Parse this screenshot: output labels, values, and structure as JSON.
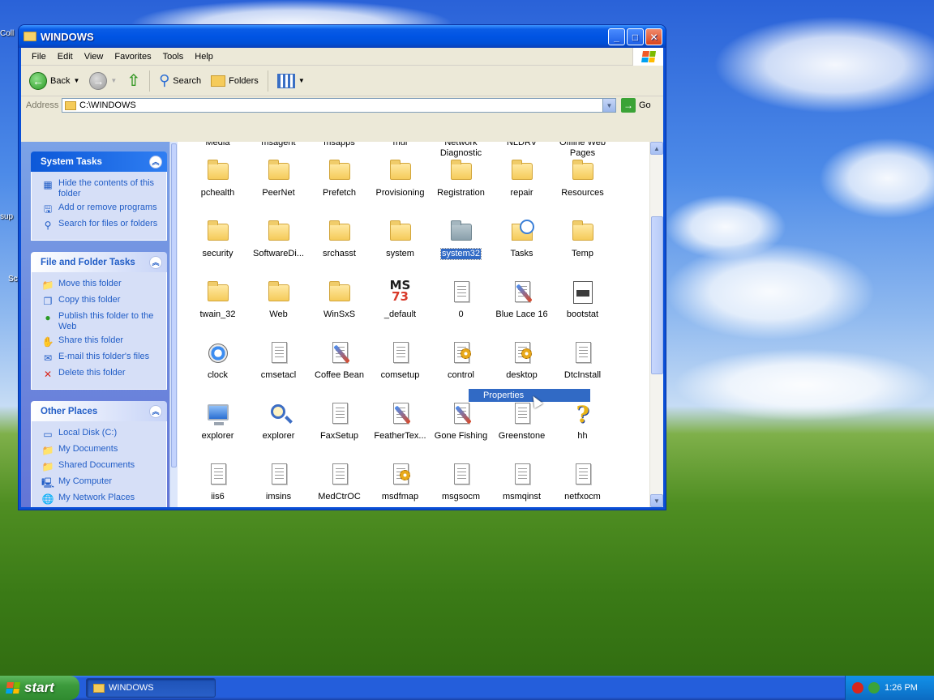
{
  "window": {
    "title": "WINDOWS",
    "menus": [
      "File",
      "Edit",
      "View",
      "Favorites",
      "Tools",
      "Help"
    ]
  },
  "toolbar": {
    "back": "Back",
    "search": "Search",
    "folders": "Folders"
  },
  "address": {
    "label": "Address",
    "value": "C:\\WINDOWS",
    "go": "Go"
  },
  "taskpane": {
    "system_tasks": {
      "title": "System Tasks",
      "items": [
        "Hide the contents of this folder",
        "Add or remove programs",
        "Search for files or folders"
      ]
    },
    "file_tasks": {
      "title": "File and Folder Tasks",
      "items": [
        "Move this folder",
        "Copy this folder",
        "Publish this folder to the Web",
        "Share this folder",
        "E-mail this folder's files",
        "Delete this folder"
      ]
    },
    "other_places": {
      "title": "Other Places",
      "items": [
        "Local Disk (C:)",
        "My Documents",
        "Shared Documents",
        "My Computer",
        "My Network Places"
      ]
    }
  },
  "files": {
    "row0": [
      "Media",
      "msagent",
      "msapps",
      "mui",
      "Network Diagnostic",
      "NLDRV",
      "Offline Web Pages"
    ],
    "row1": [
      "pchealth",
      "PeerNet",
      "Prefetch",
      "Provisioning",
      "Registration",
      "repair",
      "Resources"
    ],
    "row2": [
      "security",
      "SoftwareDi...",
      "srchasst",
      "system",
      "system32",
      "Tasks",
      "Temp"
    ],
    "row3": [
      "twain_32",
      "Web",
      "WinSxS",
      "_default",
      "0",
      "Blue Lace 16",
      "bootstat"
    ],
    "row4": [
      "clock",
      "cmsetacl",
      "Coffee Bean",
      "comsetup",
      "control",
      "desktop",
      "DtcInstall"
    ],
    "row5": [
      "explorer",
      "explorer",
      "FaxSetup",
      "FeatherTex...",
      "Gone Fishing",
      "Greenstone",
      "hh"
    ],
    "row6": [
      "iis6",
      "imsins",
      "MedCtrOC",
      "msdfmap",
      "msgsocm",
      "msmqinst",
      "netfxocm"
    ]
  },
  "context_menu": {
    "item": "Properties"
  },
  "desktop": {
    "labels": [
      "Coll",
      "sup",
      "Sc"
    ]
  },
  "taskbar": {
    "start": "start",
    "window_button": "WINDOWS",
    "clock": "1:26 PM"
  }
}
